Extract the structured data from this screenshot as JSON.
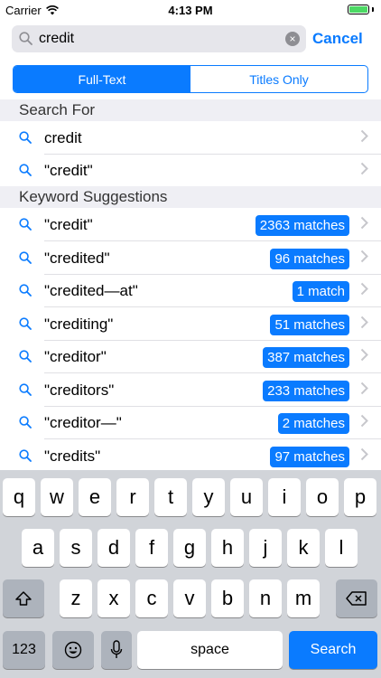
{
  "status": {
    "carrier": "Carrier",
    "time": "4:13 PM"
  },
  "search": {
    "value": "credit",
    "cancel_label": "Cancel"
  },
  "segments": [
    {
      "label": "Full-Text",
      "active": true
    },
    {
      "label": "Titles Only",
      "active": false
    }
  ],
  "search_for": {
    "header": "Search For",
    "items": [
      {
        "label": "credit"
      },
      {
        "label": "\"credit\""
      }
    ]
  },
  "suggestions": {
    "header": "Keyword Suggestions",
    "items": [
      {
        "label": "\"credit\"",
        "badge": "2363 matches"
      },
      {
        "label": "\"credited\"",
        "badge": "96 matches"
      },
      {
        "label": "\"credited—at\"",
        "badge": "1 match"
      },
      {
        "label": "\"crediting\"",
        "badge": "51 matches"
      },
      {
        "label": "\"creditor\"",
        "badge": "387 matches"
      },
      {
        "label": "\"creditors\"",
        "badge": "233 matches"
      },
      {
        "label": "\"creditor—\"",
        "badge": "2 matches"
      },
      {
        "label": "\"credits\"",
        "badge": "97 matches"
      }
    ]
  },
  "keyboard": {
    "row1": [
      "q",
      "w",
      "e",
      "r",
      "t",
      "y",
      "u",
      "i",
      "o",
      "p"
    ],
    "row2": [
      "a",
      "s",
      "d",
      "f",
      "g",
      "h",
      "j",
      "k",
      "l"
    ],
    "row3": [
      "z",
      "x",
      "c",
      "v",
      "b",
      "n",
      "m"
    ],
    "numbers_label": "123",
    "space_label": "space",
    "search_label": "Search"
  },
  "colors": {
    "accent": "#0a7bff",
    "section_bg": "#efeff4",
    "keyboard_bg": "#d1d4d9"
  },
  "icons": [
    "wifi-icon",
    "battery-icon",
    "search-icon",
    "clear-icon",
    "chevron-right-icon",
    "shift-icon",
    "delete-icon",
    "emoji-icon",
    "microphone-icon"
  ]
}
